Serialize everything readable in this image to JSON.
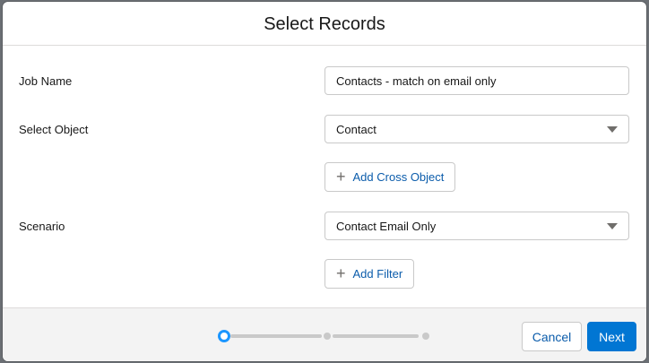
{
  "modal": {
    "title": "Select Records"
  },
  "form": {
    "job_name_label": "Job Name",
    "job_name_value": "Contacts - match on email only",
    "object_label": "Select Object",
    "object_value": "Contact",
    "add_cross_object_label": "Add Cross Object",
    "scenario_label": "Scenario",
    "scenario_value": "Contact Email Only",
    "add_filter_label": "Add Filter"
  },
  "progress": {
    "total_steps": 3,
    "current_step": 1
  },
  "footer": {
    "cancel_label": "Cancel",
    "next_label": "Next"
  },
  "colors": {
    "brand": "#0176d3",
    "link": "#0b5cab",
    "active_step": "#1b96ff"
  },
  "icons": {
    "plus": "plus-icon",
    "dropdown": "chevron-down-icon"
  }
}
